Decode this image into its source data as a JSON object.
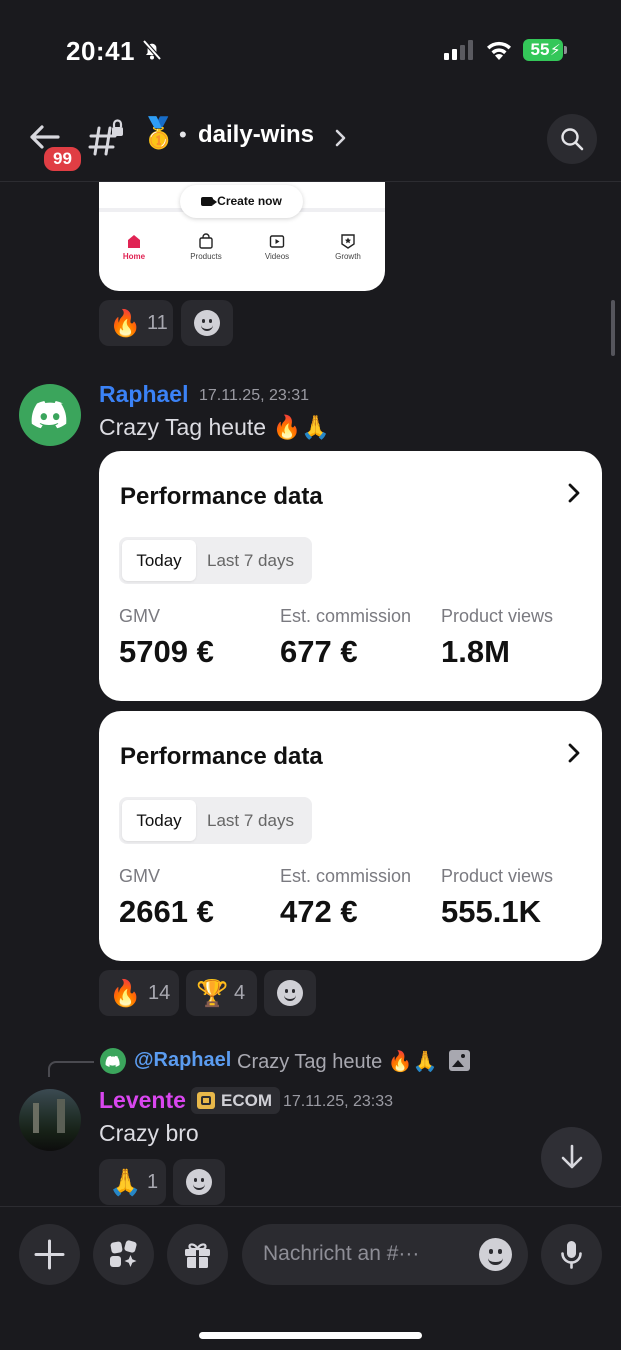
{
  "status_bar": {
    "time": "20:41",
    "battery": "55"
  },
  "header": {
    "unread_badge": "99",
    "channel_emoji": "🥇",
    "channel_dot": "•",
    "channel_name": "daily-wins"
  },
  "prev_card": {
    "create_button": "Create now",
    "tabs": [
      {
        "label": "Home",
        "icon": "home-icon"
      },
      {
        "label": "Products",
        "icon": "shopping-bag-icon"
      },
      {
        "label": "Videos",
        "icon": "video-icon"
      },
      {
        "label": "Growth",
        "icon": "badge-icon"
      }
    ]
  },
  "prev_reactions": {
    "fire": {
      "emoji": "🔥",
      "count": "11"
    }
  },
  "message1": {
    "author": "Raphael",
    "author_color": "#3b82f6",
    "timestamp": "17.11.25, 23:31",
    "text": "Crazy Tag heute 🔥🙏",
    "cards": [
      {
        "title": "Performance data",
        "tab_active": "Today",
        "tab_inactive": "Last 7 days",
        "metrics": [
          {
            "label": "GMV",
            "value": "5709 €"
          },
          {
            "label": "Est. commission",
            "value": "677 €"
          },
          {
            "label": "Product views",
            "value": "1.8M"
          }
        ]
      },
      {
        "title": "Performance data",
        "tab_active": "Today",
        "tab_inactive": "Last 7 days",
        "metrics": [
          {
            "label": "GMV",
            "value": "2661 €"
          },
          {
            "label": "Est. commission",
            "value": "472 €"
          },
          {
            "label": "Product views",
            "value": "555.1K"
          }
        ]
      }
    ],
    "reactions": [
      {
        "emoji": "🔥",
        "count": "14"
      },
      {
        "emoji": "🏆",
        "count": "4"
      }
    ]
  },
  "message2": {
    "reply": {
      "mention": "@Raphael",
      "text": "Crazy Tag heute 🔥🙏"
    },
    "author": "Levente",
    "author_color": "#d946ef",
    "tag": "ECOM",
    "timestamp": "17.11.25, 23:33",
    "text": "Crazy bro",
    "reactions": [
      {
        "emoji": "🙏",
        "count": "1"
      }
    ]
  },
  "composer": {
    "placeholder": "Nachricht an #···"
  }
}
